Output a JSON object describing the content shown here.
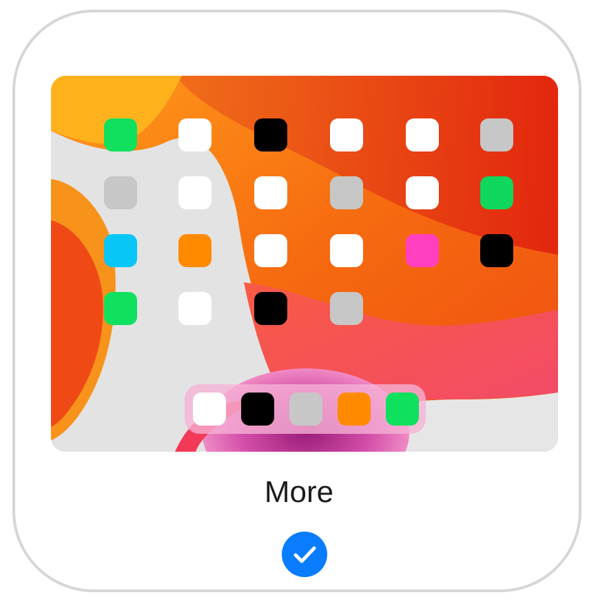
{
  "option": {
    "label": "More",
    "selected": true,
    "check_icon": "checkmark-icon",
    "accent_color": "#0a7cff"
  },
  "home_screen": {
    "grid_rows": [
      [
        "#0fe05e",
        "#ffffff",
        "#000000",
        "#ffffff",
        "#ffffff",
        "#c7c7c7"
      ],
      [
        "#c7c7c7",
        "#ffffff",
        "#ffffff",
        "#c7c7c7",
        "#ffffff",
        "#0fd65c"
      ],
      [
        "#08c6f7",
        "#ff8a00",
        "#ffffff",
        "#ffffff",
        "#ff3fbf",
        "#000000"
      ],
      [
        "#0fe05e",
        "#ffffff",
        "#000000",
        "#c7c7c7"
      ]
    ],
    "dock": [
      "#ffffff",
      "#000000",
      "#c7c7c7",
      "#ff8a00",
      "#0fe05e"
    ]
  }
}
